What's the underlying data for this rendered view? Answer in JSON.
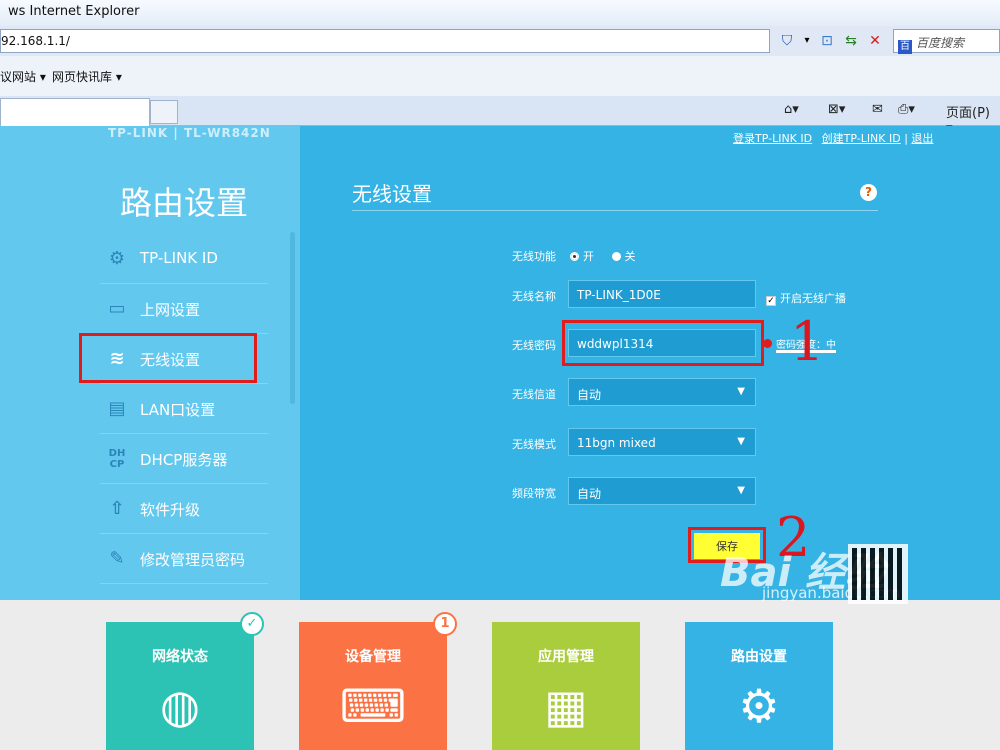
{
  "browser": {
    "title": "ws Internet Explorer",
    "address": "92.168.1.1/",
    "search_placeholder": "百度搜索",
    "favorites": [
      "议网站 ▾",
      "网页快讯库 ▾"
    ],
    "page_menu": "页面(P) ▾"
  },
  "header": {
    "logo": "TP-LINK | TL-WR842N",
    "links": [
      "登录TP-LINK ID",
      "创建TP-LINK ID",
      "退出"
    ]
  },
  "sidebar": {
    "title": "路由设置",
    "items": [
      {
        "label": "TP-LINK ID",
        "icon": "gear-icon"
      },
      {
        "label": "上网设置",
        "icon": "monitor-icon"
      },
      {
        "label": "无线设置",
        "icon": "wifi-icon"
      },
      {
        "label": "LAN口设置",
        "icon": "lan-icon"
      },
      {
        "label": "DHCP服务器",
        "icon": "dhcp-icon"
      },
      {
        "label": "软件升级",
        "icon": "upload-icon"
      },
      {
        "label": "修改管理员密码",
        "icon": "pencil-icon"
      }
    ]
  },
  "wireless": {
    "title": "无线设置",
    "function_label": "无线功能",
    "on_label": "开",
    "off_label": "关",
    "ssid_label": "无线名称",
    "ssid_value": "TP-LINK_1D0E",
    "broadcast_label": "开启无线广播",
    "password_label": "无线密码",
    "password_value": "wddwpl1314",
    "strength_text": "密码强度：中",
    "channel_label": "无线信道",
    "channel_value": "自动",
    "mode_label": "无线模式",
    "mode_value": "11bgn mixed",
    "bandwidth_label": "频段带宽",
    "bandwidth_value": "自动",
    "save_label": "保存",
    "step1": "1",
    "step2": "2"
  },
  "tiles": [
    {
      "label": "网络状态",
      "color": "#2cc3b4",
      "badge": "✓"
    },
    {
      "label": "设备管理",
      "color": "#fb7345",
      "badge": "1"
    },
    {
      "label": "应用管理",
      "color": "#a9cd3c"
    },
    {
      "label": "路由设置",
      "color": "#35b3e4"
    }
  ],
  "watermark": {
    "main": "Bai 经验",
    "sub": "jingyan.baidu.com"
  }
}
